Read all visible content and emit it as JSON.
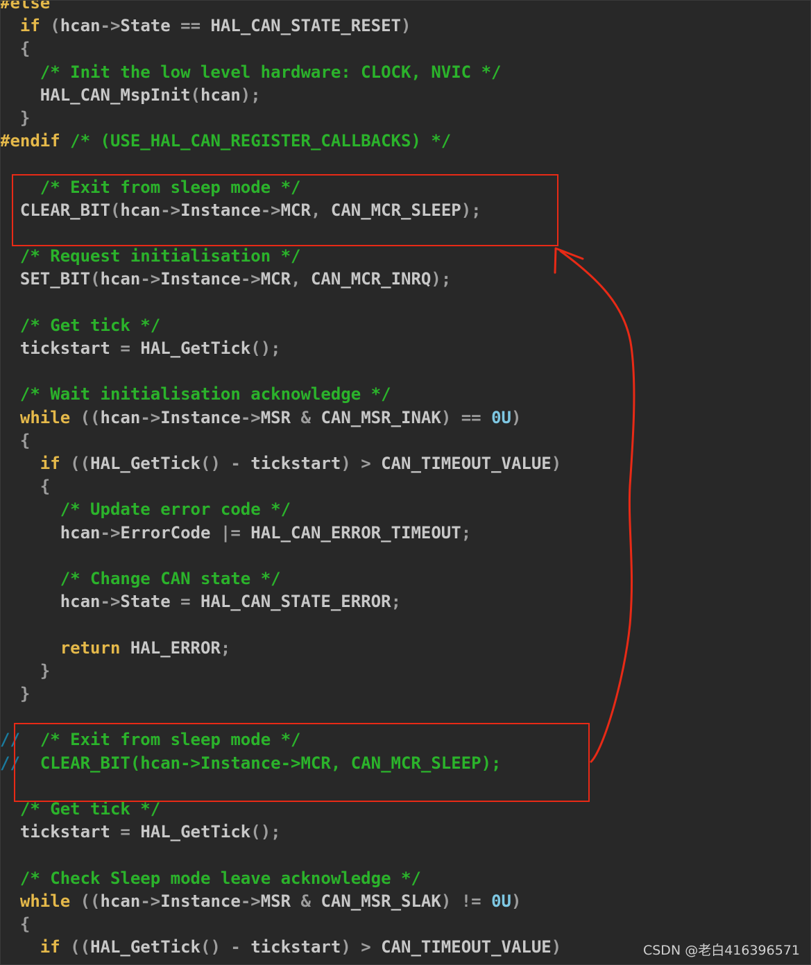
{
  "code": {
    "lines": [
      [
        {
          "t": "#else",
          "c": "pp"
        }
      ],
      [
        {
          "t": "  "
        },
        {
          "t": "if",
          "c": "kw"
        },
        {
          "t": " (",
          "c": "pu"
        },
        {
          "t": "hcan",
          "c": "id"
        },
        {
          "t": "->",
          "c": "pu"
        },
        {
          "t": "State",
          "c": "id"
        },
        {
          "t": " == ",
          "c": "pu"
        },
        {
          "t": "HAL_CAN_STATE_RESET",
          "c": "mac"
        },
        {
          "t": ")",
          "c": "pu"
        }
      ],
      [
        {
          "t": "  "
        },
        {
          "t": "{",
          "c": "pu"
        }
      ],
      [
        {
          "t": "    "
        },
        {
          "t": "/* Init the low level hardware: CLOCK, NVIC */",
          "c": "cm"
        }
      ],
      [
        {
          "t": "    "
        },
        {
          "t": "HAL_CAN_MspInit",
          "c": "id"
        },
        {
          "t": "(",
          "c": "pu"
        },
        {
          "t": "hcan",
          "c": "id"
        },
        {
          "t": ");",
          "c": "pu"
        }
      ],
      [
        {
          "t": "  "
        },
        {
          "t": "}",
          "c": "pu"
        }
      ],
      [
        {
          "t": "#endif",
          "c": "pp"
        },
        {
          "t": " "
        },
        {
          "t": "/* (USE_HAL_CAN_REGISTER_CALLBACKS) */",
          "c": "cm"
        }
      ],
      [],
      [
        {
          "t": "    "
        },
        {
          "t": "/* Exit from sleep mode */",
          "c": "cm"
        }
      ],
      [
        {
          "t": "  "
        },
        {
          "t": "CLEAR_BIT",
          "c": "mac"
        },
        {
          "t": "(",
          "c": "pu"
        },
        {
          "t": "hcan",
          "c": "id"
        },
        {
          "t": "->",
          "c": "pu"
        },
        {
          "t": "Instance",
          "c": "id"
        },
        {
          "t": "->",
          "c": "pu"
        },
        {
          "t": "MCR",
          "c": "id"
        },
        {
          "t": ", ",
          "c": "pu"
        },
        {
          "t": "CAN_MCR_SLEEP",
          "c": "mac"
        },
        {
          "t": ");",
          "c": "pu"
        }
      ],
      [],
      [
        {
          "t": "  "
        },
        {
          "t": "/* Request initialisation */",
          "c": "cm"
        }
      ],
      [
        {
          "t": "  "
        },
        {
          "t": "SET_BIT",
          "c": "mac"
        },
        {
          "t": "(",
          "c": "pu"
        },
        {
          "t": "hcan",
          "c": "id"
        },
        {
          "t": "->",
          "c": "pu"
        },
        {
          "t": "Instance",
          "c": "id"
        },
        {
          "t": "->",
          "c": "pu"
        },
        {
          "t": "MCR",
          "c": "id"
        },
        {
          "t": ", ",
          "c": "pu"
        },
        {
          "t": "CAN_MCR_INRQ",
          "c": "mac"
        },
        {
          "t": ");",
          "c": "pu"
        }
      ],
      [],
      [
        {
          "t": "  "
        },
        {
          "t": "/* Get tick */",
          "c": "cm"
        }
      ],
      [
        {
          "t": "  "
        },
        {
          "t": "tickstart",
          "c": "id"
        },
        {
          "t": " = ",
          "c": "pu"
        },
        {
          "t": "HAL_GetTick",
          "c": "id"
        },
        {
          "t": "();",
          "c": "pu"
        }
      ],
      [],
      [
        {
          "t": "  "
        },
        {
          "t": "/* Wait initialisation acknowledge */",
          "c": "cm"
        }
      ],
      [
        {
          "t": "  "
        },
        {
          "t": "while",
          "c": "kw"
        },
        {
          "t": " ((",
          "c": "pu"
        },
        {
          "t": "hcan",
          "c": "id"
        },
        {
          "t": "->",
          "c": "pu"
        },
        {
          "t": "Instance",
          "c": "id"
        },
        {
          "t": "->",
          "c": "pu"
        },
        {
          "t": "MSR",
          "c": "id"
        },
        {
          "t": " & ",
          "c": "pu"
        },
        {
          "t": "CAN_MSR_INAK",
          "c": "mac"
        },
        {
          "t": ") == ",
          "c": "pu"
        },
        {
          "t": "0U",
          "c": "num"
        },
        {
          "t": ")",
          "c": "pu"
        }
      ],
      [
        {
          "t": "  "
        },
        {
          "t": "{",
          "c": "pu"
        }
      ],
      [
        {
          "t": "    "
        },
        {
          "t": "if",
          "c": "kw"
        },
        {
          "t": " ((",
          "c": "pu"
        },
        {
          "t": "HAL_GetTick",
          "c": "id"
        },
        {
          "t": "() - ",
          "c": "pu"
        },
        {
          "t": "tickstart",
          "c": "id"
        },
        {
          "t": ") > ",
          "c": "pu"
        },
        {
          "t": "CAN_TIMEOUT_VALUE",
          "c": "mac"
        },
        {
          "t": ")",
          "c": "pu"
        }
      ],
      [
        {
          "t": "    "
        },
        {
          "t": "{",
          "c": "pu"
        }
      ],
      [
        {
          "t": "      "
        },
        {
          "t": "/* Update error code */",
          "c": "cm"
        }
      ],
      [
        {
          "t": "      "
        },
        {
          "t": "hcan",
          "c": "id"
        },
        {
          "t": "->",
          "c": "pu"
        },
        {
          "t": "ErrorCode",
          "c": "id"
        },
        {
          "t": " |= ",
          "c": "pu"
        },
        {
          "t": "HAL_CAN_ERROR_TIMEOUT",
          "c": "mac"
        },
        {
          "t": ";",
          "c": "pu"
        }
      ],
      [],
      [
        {
          "t": "      "
        },
        {
          "t": "/* Change CAN state */",
          "c": "cm"
        }
      ],
      [
        {
          "t": "      "
        },
        {
          "t": "hcan",
          "c": "id"
        },
        {
          "t": "->",
          "c": "pu"
        },
        {
          "t": "State",
          "c": "id"
        },
        {
          "t": " = ",
          "c": "pu"
        },
        {
          "t": "HAL_CAN_STATE_ERROR",
          "c": "mac"
        },
        {
          "t": ";",
          "c": "pu"
        }
      ],
      [],
      [
        {
          "t": "      "
        },
        {
          "t": "return",
          "c": "kw"
        },
        {
          "t": " "
        },
        {
          "t": "HAL_ERROR",
          "c": "mac"
        },
        {
          "t": ";",
          "c": "pu"
        }
      ],
      [
        {
          "t": "    "
        },
        {
          "t": "}",
          "c": "pu"
        }
      ],
      [
        {
          "t": "  "
        },
        {
          "t": "}",
          "c": "pu"
        }
      ],
      [],
      [
        {
          "t": "//",
          "c": "cmt-dbl"
        },
        {
          "t": "  "
        },
        {
          "t": "/* Exit from sleep mode */",
          "c": "cm"
        }
      ],
      [
        {
          "t": "//",
          "c": "cmt-dbl"
        },
        {
          "t": "  "
        },
        {
          "t": "CLEAR_BIT(hcan->Instance->MCR, CAN_MCR_SLEEP);",
          "c": "cm"
        }
      ],
      [],
      [
        {
          "t": "  "
        },
        {
          "t": "/* Get tick */",
          "c": "cm"
        }
      ],
      [
        {
          "t": "  "
        },
        {
          "t": "tickstart",
          "c": "id"
        },
        {
          "t": " = ",
          "c": "pu"
        },
        {
          "t": "HAL_GetTick",
          "c": "id"
        },
        {
          "t": "();",
          "c": "pu"
        }
      ],
      [],
      [
        {
          "t": "  "
        },
        {
          "t": "/* Check Sleep mode leave acknowledge */",
          "c": "cm"
        }
      ],
      [
        {
          "t": "  "
        },
        {
          "t": "while",
          "c": "kw"
        },
        {
          "t": " ((",
          "c": "pu"
        },
        {
          "t": "hcan",
          "c": "id"
        },
        {
          "t": "->",
          "c": "pu"
        },
        {
          "t": "Instance",
          "c": "id"
        },
        {
          "t": "->",
          "c": "pu"
        },
        {
          "t": "MSR",
          "c": "id"
        },
        {
          "t": " & ",
          "c": "pu"
        },
        {
          "t": "CAN_MSR_SLAK",
          "c": "mac"
        },
        {
          "t": ") != ",
          "c": "pu"
        },
        {
          "t": "0U",
          "c": "num"
        },
        {
          "t": ")",
          "c": "pu"
        }
      ],
      [
        {
          "t": "  "
        },
        {
          "t": "{",
          "c": "pu"
        }
      ],
      [
        {
          "t": "    "
        },
        {
          "t": "if",
          "c": "kw"
        },
        {
          "t": " ((",
          "c": "pu"
        },
        {
          "t": "HAL_GetTick",
          "c": "id"
        },
        {
          "t": "() - ",
          "c": "pu"
        },
        {
          "t": "tickstart",
          "c": "id"
        },
        {
          "t": ") > ",
          "c": "pu"
        },
        {
          "t": "CAN_TIMEOUT_VALUE",
          "c": "mac"
        },
        {
          "t": ")",
          "c": "pu"
        }
      ]
    ]
  },
  "watermark": "CSDN @老白416396571",
  "annotation_color": "#e82a16"
}
